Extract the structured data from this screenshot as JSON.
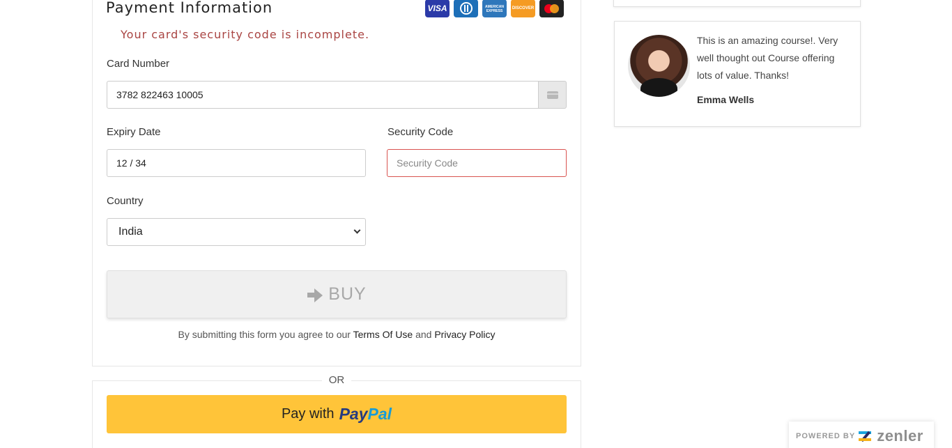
{
  "payment": {
    "title": "Payment Information",
    "error": "Your card's security code is incomplete.",
    "card_number_label": "Card Number",
    "card_number_value": "3782 822463 10005",
    "expiry_label": "Expiry Date",
    "expiry_value": "12 / 34",
    "security_label": "Security Code",
    "security_placeholder": "Security Code",
    "country_label": "Country",
    "country_value": "India",
    "buy_label": "BUY",
    "card_logos": [
      "VISA",
      "Diners Club",
      "AMERICAN EXPRESS",
      "DISCOVER",
      "Mastercard"
    ]
  },
  "terms": {
    "prefix": "By submitting this form you agree to our",
    "terms_link": "Terms Of Use",
    "and": "and",
    "privacy_link": "Privacy Policy"
  },
  "or_text": "OR",
  "paypal": {
    "prefix": "Pay with",
    "logo_a": "Pay",
    "logo_b": "Pal"
  },
  "testimonial": {
    "quote": "This is an amazing course!. Very well thought out Course offering lots of value. Thanks!",
    "author": "Emma Wells"
  },
  "powered": {
    "label": "POWERED BY",
    "brand": "zenler"
  },
  "colors": {
    "error": "#a94442",
    "paypal_yellow": "#ffc439",
    "paypal_dark_blue": "#253b80",
    "paypal_light_blue": "#179bd7"
  }
}
